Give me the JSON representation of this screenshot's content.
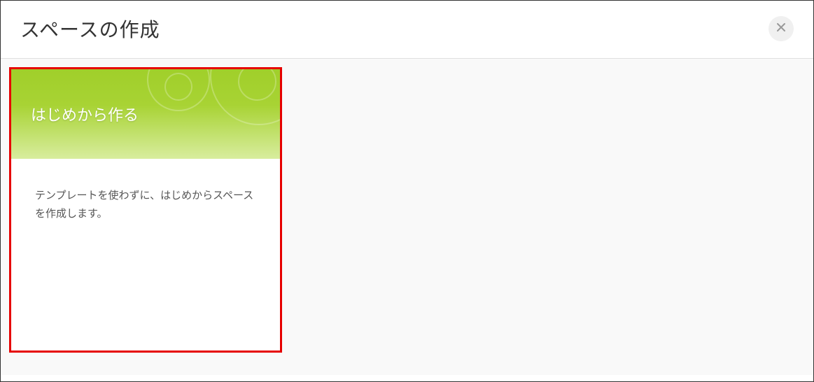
{
  "dialog": {
    "title": "スペースの作成"
  },
  "templates": [
    {
      "title": "はじめから作る",
      "description": "テンプレートを使わずに、はじめからスペースを作成します。"
    }
  ]
}
